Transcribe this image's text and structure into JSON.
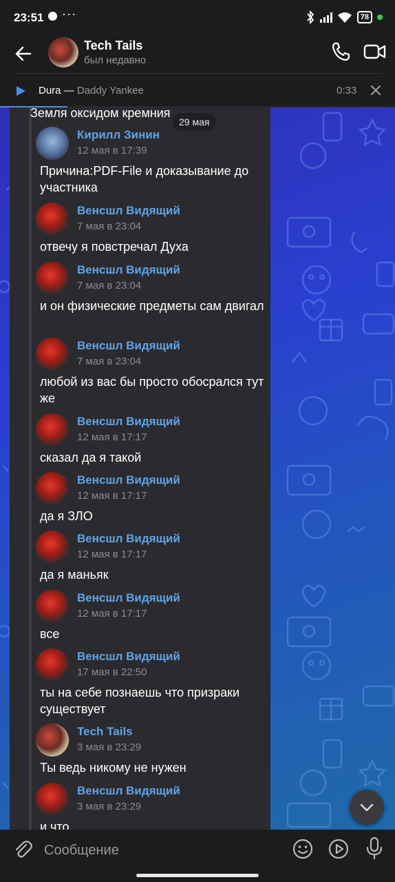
{
  "status_bar": {
    "time": "23:51",
    "dots": "···",
    "battery": "78"
  },
  "header": {
    "title": "Tech Tails",
    "subtitle": "был недавно"
  },
  "audio": {
    "track": "Dura",
    "separator": " — ",
    "artist": "Daddy Yankee",
    "time": "0:33",
    "progress": 0.17
  },
  "chat": {
    "date_pill": "29 мая",
    "top_partial_text": "Земля оксидом кремния",
    "messages": [
      {
        "name": "Кирилл Зинин",
        "date": "12 мая в 17:39",
        "text": "Причина:PDF-File и доказывание до участника",
        "avatar": "blue"
      },
      {
        "name": "Венсшл Видящий",
        "date": "7 мая в 23:04",
        "text": "отвечу я повстречал Духа",
        "avatar": "red"
      },
      {
        "name": "Венсшл Видящий",
        "date": "7 мая в 23:04",
        "text": "и он физические предметы сам двигал",
        "avatar": "red"
      },
      {
        "name": "Венсшл Видящий",
        "date": "7 мая в 23:04",
        "text": "любой из вас бы просто обосрался тут же",
        "avatar": "red"
      },
      {
        "name": "Венсшл Видящий",
        "date": "12 мая в 17:17",
        "text": "сказал да я такой",
        "avatar": "red"
      },
      {
        "name": "Венсшл Видящий",
        "date": "12 мая в 17:17",
        "text": "да я ЗЛО",
        "avatar": "red"
      },
      {
        "name": "Венсшл Видящий",
        "date": "12 мая в 17:17",
        "text": "да я маньяк",
        "avatar": "red"
      },
      {
        "name": "Венсшл Видящий",
        "date": "12 мая в 17:17",
        "text": "все",
        "avatar": "red"
      },
      {
        "name": "Венсшл Видящий",
        "date": "17 мая в 22:50",
        "text": "ты на себе познаешь что призраки существует",
        "avatar": "red"
      },
      {
        "name": "Tech Tails",
        "date": "3 мая в 23:29",
        "text": "Ты ведь  никому не нужен",
        "avatar": "tech"
      },
      {
        "name": "Венсшл Видящий",
        "date": "3 мая в 23:29",
        "text": "и что",
        "avatar": "red"
      }
    ]
  },
  "input": {
    "placeholder": "Сообщение",
    "value": ""
  },
  "colors": {
    "accent": "#4a90e2",
    "name": "#5ea4e8",
    "bubble": "#2b2b2f",
    "bar": "#1c1c1e"
  },
  "icons": [
    "back-arrow-icon",
    "phone-icon",
    "video-icon",
    "play-icon",
    "close-icon",
    "chevron-down-icon",
    "attach-icon",
    "emoji-icon",
    "sticker-icon",
    "mic-icon"
  ]
}
